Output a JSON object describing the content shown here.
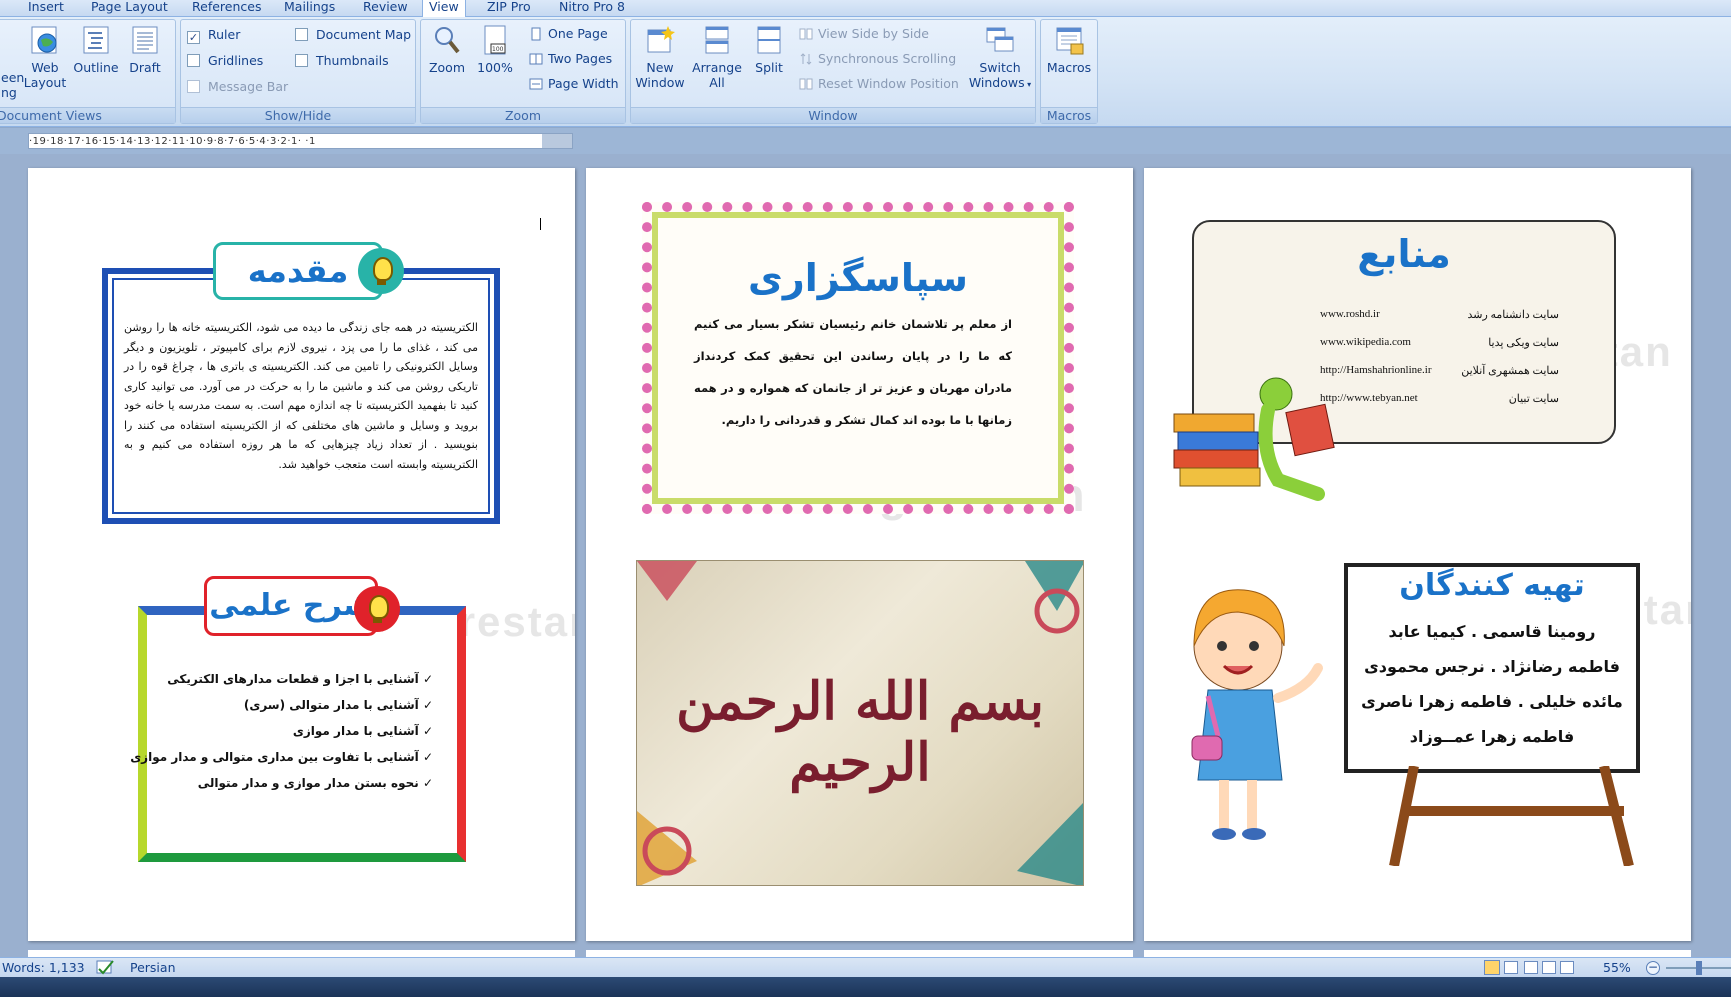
{
  "tabs": [
    "Insert",
    "Page Layout",
    "References",
    "Mailings",
    "Review",
    "View",
    "ZIP Pro",
    "Nitro Pro 8"
  ],
  "active_tab": "View",
  "groups": {
    "document_views": {
      "label": "Document Views",
      "partial_left": "een\nng",
      "buttons": [
        {
          "label1": "Web",
          "label2": "Layout",
          "icon": "web-layout-icon"
        },
        {
          "label1": "Outline",
          "label2": "",
          "icon": "outline-icon"
        },
        {
          "label1": "Draft",
          "label2": "",
          "icon": "draft-icon"
        }
      ]
    },
    "show_hide": {
      "label": "Show/Hide",
      "items": [
        {
          "label": "Ruler",
          "checked": true
        },
        {
          "label": "Gridlines",
          "checked": false
        },
        {
          "label": "Message Bar",
          "checked": false,
          "disabled": true
        },
        {
          "label": "Document Map",
          "checked": false
        },
        {
          "label": "Thumbnails",
          "checked": false
        }
      ]
    },
    "zoom": {
      "label": "Zoom",
      "zoom_label": "Zoom",
      "hundred_label": "100%",
      "items": [
        "One Page",
        "Two Pages",
        "Page Width"
      ]
    },
    "window": {
      "label": "Window",
      "buttons": [
        {
          "label1": "New",
          "label2": "Window"
        },
        {
          "label1": "Arrange",
          "label2": "All"
        },
        {
          "label1": "Split",
          "label2": ""
        }
      ],
      "small": [
        "View Side by Side",
        "Synchronous Scrolling",
        "Reset Window Position"
      ],
      "switch1": "Switch",
      "switch2": "Windows"
    },
    "macros": {
      "label": "Macros",
      "button": "Macros"
    }
  },
  "ruler_text": "·19·18·17·16·15·14·13·12·11·10·9·8·7·6·5·4·3·2·1·  ·1",
  "pages": {
    "intro": {
      "title": "مقدمه",
      "paragraph": "الکتریسیته در همه جای زندگی ما دیده می شود، الکتریسیته خانه ها را روشن می کند ، غذای ما را می پزد ، نیروی لازم برای کامپیوتر ، تلویزیون و دیگر وسایل الکترونیکی را تامین می کند. الکتریسیته ی باتری ها ، چراغ قوه را در تاریکی روشن می کند و ماشین ما را به حرکت در می آورد. می توانید کاری کنید تا بفهمید الکتریسیته تا چه اندازه مهم است. به سمت مدرسه یا خانه خود بروید و وسایل و ماشین های مختلفی که از الکتریسیته استفاده می کنند را بنویسید . از تعداد زیاد چیزهایی که ما هر روزه استفاده می کنیم و به الکتریسیته وابسته است متعجب خواهید شد."
    },
    "science": {
      "title": "شرح علمی",
      "items": [
        "آشنایی با اجزا و قطعات مدارهای الکتریکی",
        "آشنایی با مدار متوالی (سری)",
        "آشنایی با مدار موازی",
        "آشنایی با تفاوت بین مداری متوالی و مدار موازی",
        "نحوه بستن مدار موازی و مدار متوالی"
      ]
    },
    "thanks": {
      "title": "سپاسگزاری",
      "paragraph": "از معلم پر تلاشمان خانم رئیسیان تشکر بسیار می کنیم که ما را در پایان رساندن این تحقیق کمک کردنداز مادران مهربان و عزیز تر از جانمان که همواره و در همه زمانها با ما بوده اند کمال تشکر و قدردانی را داریم."
    },
    "callig_text": "بسم الله الرحمن الرحیم",
    "sources": {
      "title": "منابع",
      "rows": [
        {
          "name": "سایت دانشنامه رشد",
          "url": "www.roshd.ir"
        },
        {
          "name": "سایت ویکی پدیا",
          "url": "www.wikipedia.com"
        },
        {
          "name": "سایت همشهری آنلاین",
          "url": "http://Hamshahrionline.ir"
        },
        {
          "name": "سایت تبیان",
          "url": "http://www.tebyan.net"
        }
      ]
    },
    "authors": {
      "title": "تهیه کنندگان",
      "lines": [
        "رومینا قاسمی . کیمیا عابد",
        "فاطمه رضانژاد . نرجس محمودی",
        "مائده خلیلی . فاطمه زهرا ناصری",
        "فاطمه زهرا عمــوزاد"
      ]
    },
    "watermark": "Negarestan"
  },
  "status": {
    "words": "Words: 1,133",
    "language": "Persian",
    "zoom": "55%"
  },
  "colors": {
    "accent_blue": "#1e4fb4",
    "title_blue": "#1a72c8",
    "ribbon_text": "#15428b"
  }
}
